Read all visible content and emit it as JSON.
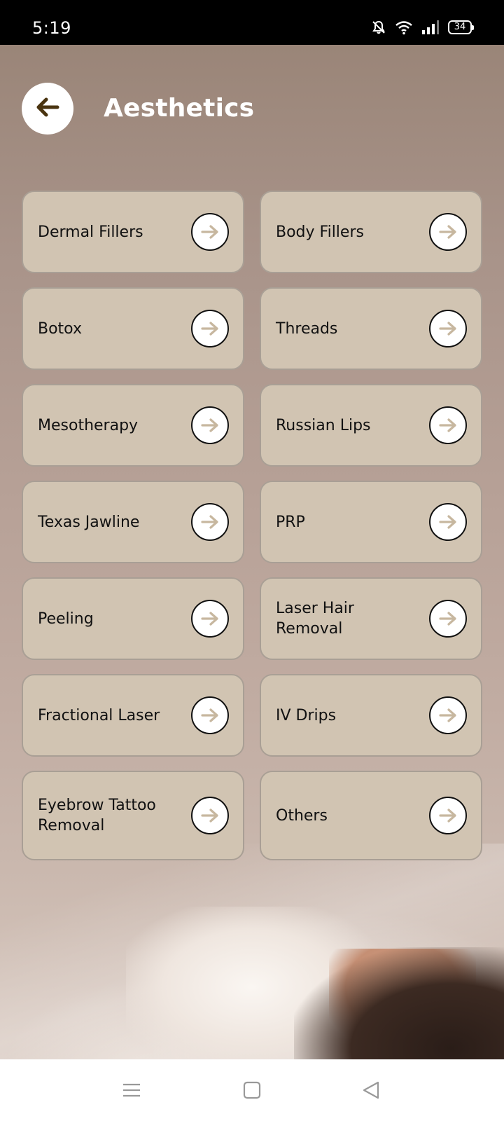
{
  "status_bar": {
    "time": "5:19",
    "battery": "34"
  },
  "header": {
    "title": "Aesthetics"
  },
  "categories": [
    {
      "label": "Dermal Fillers"
    },
    {
      "label": "Body Fillers"
    },
    {
      "label": "Botox"
    },
    {
      "label": "Threads"
    },
    {
      "label": "Mesotherapy"
    },
    {
      "label": "Russian Lips"
    },
    {
      "label": "Texas Jawline"
    },
    {
      "label": "PRP"
    },
    {
      "label": "Peeling"
    },
    {
      "label": "Laser Hair Removal"
    },
    {
      "label": "Fractional Laser"
    },
    {
      "label": "IV Drips"
    },
    {
      "label": "Eyebrow Tattoo Removal"
    },
    {
      "label": "Others"
    }
  ],
  "colors": {
    "card_bg": "#d1c4b2",
    "card_border": "#a99f95",
    "arrow_color": "#c7b79f",
    "back_arrow_color": "#4a3410"
  },
  "icons": {
    "back": "arrow-left-icon",
    "card_arrow": "arrow-right-icon",
    "nav_menu": "menu-icon",
    "nav_home": "square-home-icon",
    "nav_back": "triangle-back-icon"
  }
}
